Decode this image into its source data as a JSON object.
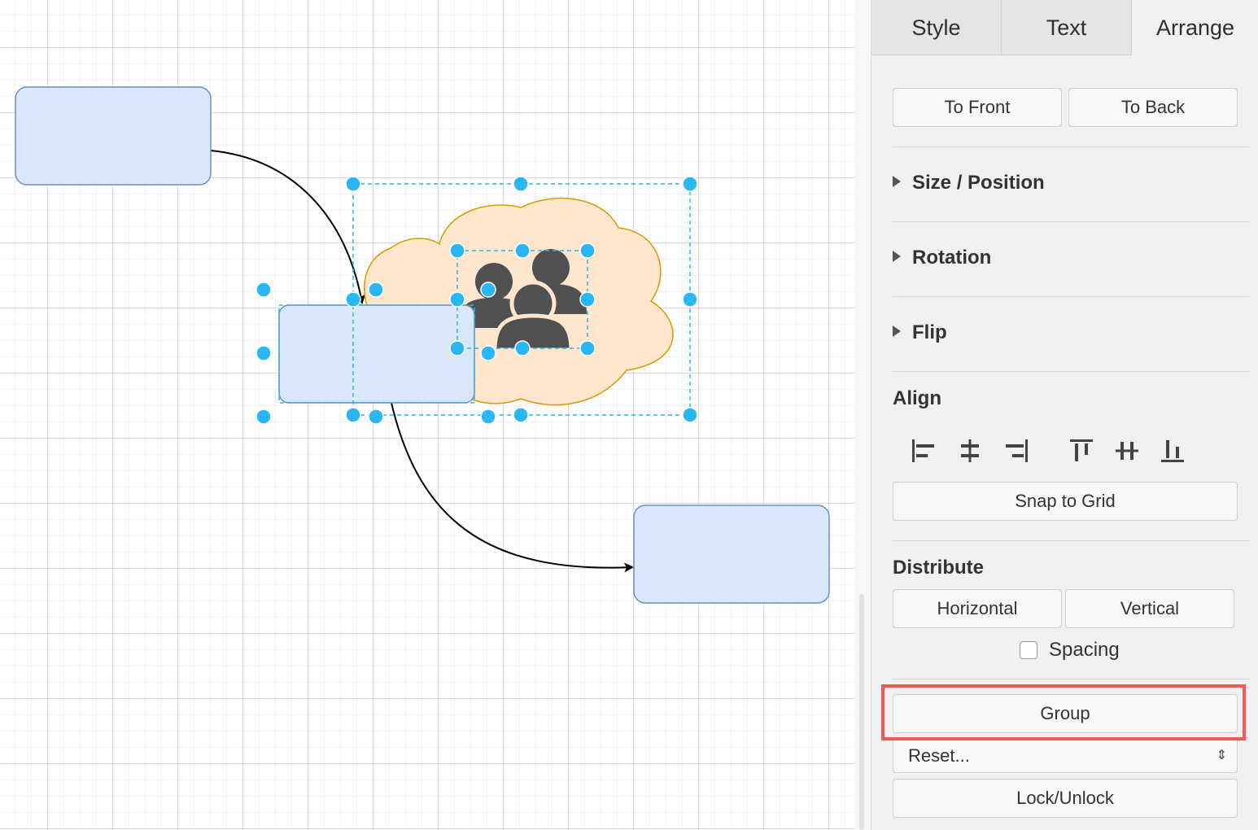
{
  "tabs": [
    {
      "label": "Style",
      "active": false
    },
    {
      "label": "Text",
      "active": false
    },
    {
      "label": "Arrange",
      "active": true
    }
  ],
  "order": {
    "to_front": "To Front",
    "to_back": "To Back"
  },
  "sections": {
    "size_position": "Size / Position",
    "rotation": "Rotation",
    "flip": "Flip",
    "align": "Align",
    "distribute": "Distribute"
  },
  "align_icons": [
    "align-left-icon",
    "align-center-icon",
    "align-right-icon",
    "align-top-icon",
    "align-middle-icon",
    "align-bottom-icon"
  ],
  "snap_to_grid": "Snap to Grid",
  "distribute": {
    "horizontal": "Horizontal",
    "vertical": "Vertical",
    "spacing_label": "Spacing",
    "spacing_checked": false
  },
  "group_button": "Group",
  "reset_select": {
    "selected": "Reset..."
  },
  "lock_unlock": "Lock/Unlock",
  "colors": {
    "shape_fill": "#dae8fc",
    "shape_stroke": "#6c8ebf",
    "cloud_fill": "#ffe6cc",
    "cloud_stroke": "#d79b00",
    "handle": "#29b6f2",
    "users_icon": "#505050",
    "highlight": "#f45a4e"
  }
}
